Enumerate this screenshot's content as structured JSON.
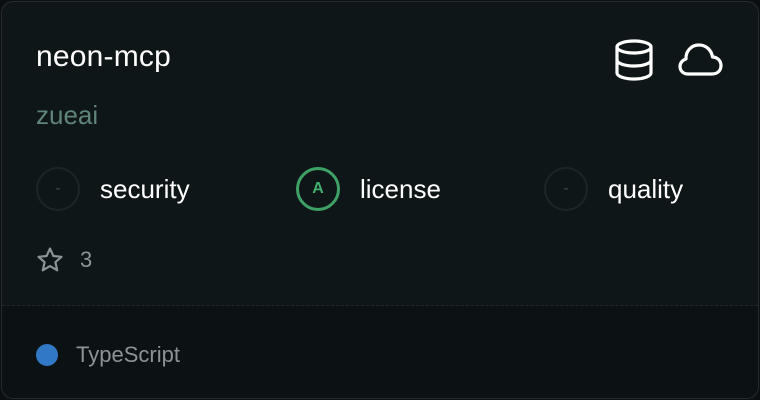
{
  "repo": {
    "name": "neon-mcp",
    "owner": "zueai",
    "icons": [
      "database-icon",
      "cloud-icon"
    ]
  },
  "scores": [
    {
      "grade": "-",
      "label": "security",
      "state": "none"
    },
    {
      "grade": "A",
      "label": "license",
      "state": "graded"
    },
    {
      "grade": "-",
      "label": "quality",
      "state": "none"
    }
  ],
  "stars": {
    "icon": "star-icon",
    "count": "3"
  },
  "language": {
    "name": "TypeScript",
    "color": "#3178c6"
  },
  "colors": {
    "grade_a": "#3ea267",
    "owner": "#5f8479",
    "background": "#0f1618"
  }
}
